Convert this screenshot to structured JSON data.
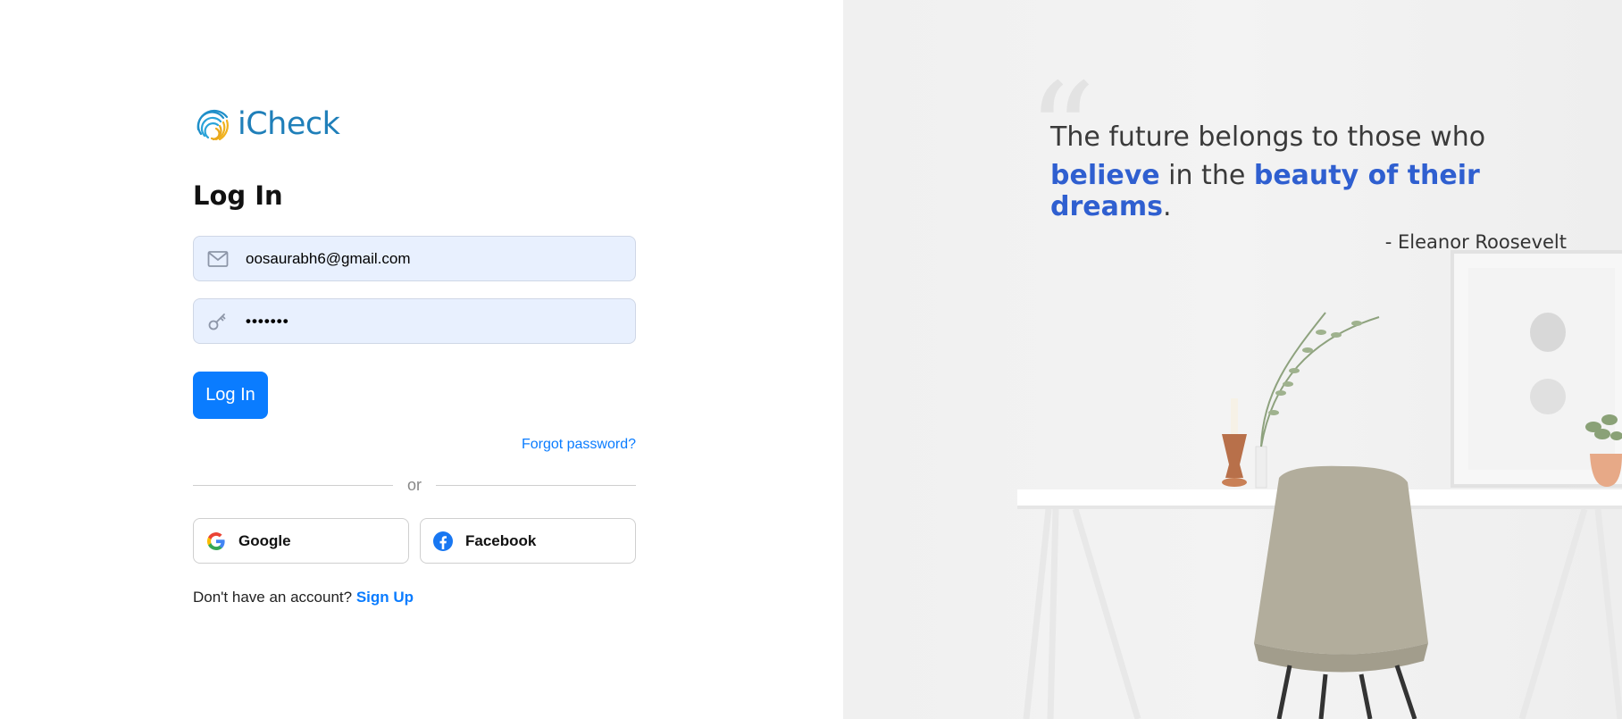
{
  "brand": {
    "name": "iCheck"
  },
  "title": "Log In",
  "email": {
    "value": "oosaurabh6@gmail.com"
  },
  "password": {
    "masked": "•••••••"
  },
  "actions": {
    "login_label": "Log In",
    "forgot_label": "Forgot password?"
  },
  "divider": {
    "label": "or"
  },
  "social": {
    "google_label": "Google",
    "facebook_label": "Facebook"
  },
  "signup": {
    "text": "Don't have an account?",
    "link_label": "Sign Up"
  },
  "quote": {
    "line1": "The future belongs to those who",
    "w_believe": "believe",
    "w_inthe": " in the ",
    "w_beauty": "beauty of their dreams",
    "w_period": ".",
    "author": "- Eleanor Roosevelt"
  },
  "colors": {
    "accent": "#0a7cff",
    "quote_highlight": "#2f5fd0",
    "input_bg": "#e8f0fe"
  },
  "icons": [
    "fingerprint-logo-icon",
    "mail-icon",
    "key-icon",
    "google-icon",
    "facebook-icon",
    "quote-icon"
  ]
}
